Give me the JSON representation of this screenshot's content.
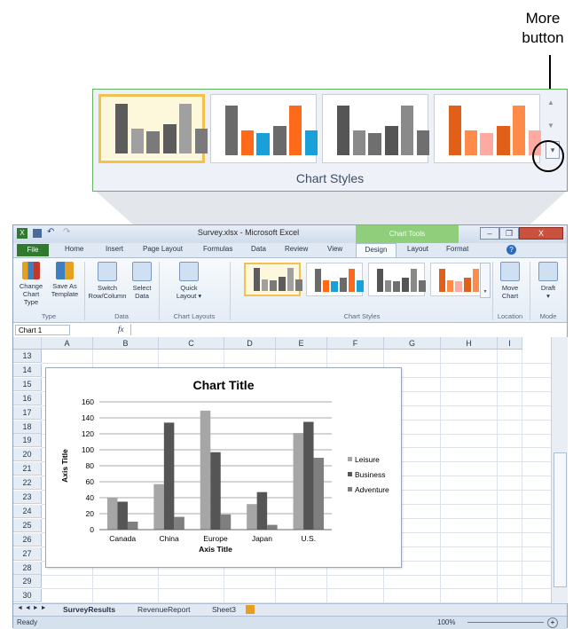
{
  "callout": {
    "line1": "More",
    "line2": "button"
  },
  "zoom": {
    "group_label": "Chart Styles"
  },
  "window": {
    "title": "Survey.xlsx - Microsoft Excel",
    "tools_label": "Chart Tools",
    "controls": {
      "minimize": "–",
      "restore": "❐",
      "close": "X"
    }
  },
  "tabs": [
    "Home",
    "Insert",
    "Page Layout",
    "Formulas",
    "Data",
    "Review",
    "View",
    "Design",
    "Layout",
    "Format"
  ],
  "file_tab": "File",
  "ribbon": {
    "change_type": {
      "line1": "Change",
      "line2": "Chart Type"
    },
    "save_template": {
      "line1": "Save As",
      "line2": "Template"
    },
    "group_type": "Type",
    "switch": {
      "line1": "Switch",
      "line2": "Row/Column"
    },
    "select_data": {
      "line1": "Select",
      "line2": "Data"
    },
    "group_data": "Data",
    "quick_layout": {
      "line1": "Quick",
      "line2": "Layout ▾"
    },
    "group_layouts": "Chart Layouts",
    "group_styles": "Chart Styles",
    "move_chart": {
      "line1": "Move",
      "line2": "Chart"
    },
    "group_location": "Location",
    "draft": {
      "line1": "Draft",
      "line2": "▾"
    },
    "group_mode": "Mode"
  },
  "formula_bar": {
    "name_box": "Chart 1",
    "fx": "fx"
  },
  "columns": [
    "A",
    "B",
    "C",
    "D",
    "E",
    "F",
    "G",
    "H",
    "I"
  ],
  "rows": [
    "13",
    "14",
    "15",
    "16",
    "17",
    "18",
    "19",
    "20",
    "21",
    "22",
    "23",
    "24",
    "25",
    "26",
    "27",
    "28",
    "29",
    "30"
  ],
  "sheet_tabs": [
    "SurveyResults",
    "RevenueReport",
    "Sheet3"
  ],
  "status": {
    "ready": "Ready",
    "zoom": "100%"
  },
  "chart_data": {
    "type": "bar",
    "title": "Chart Title",
    "xlabel": "Axis Title",
    "ylabel": "Axis Title",
    "categories": [
      "Canada",
      "China",
      "Europe",
      "Japan",
      "U.S."
    ],
    "series": [
      {
        "name": "Leisure",
        "values": [
          40,
          57,
          149,
          32,
          121
        ],
        "color": "#a6a6a6"
      },
      {
        "name": "Business",
        "values": [
          35,
          134,
          97,
          47,
          135
        ],
        "color": "#555555"
      },
      {
        "name": "Adventure",
        "values": [
          10,
          16,
          19,
          6,
          90
        ],
        "color": "#7f7f7f"
      }
    ],
    "ylim": [
      0,
      160
    ],
    "yticks": [
      "0",
      "20",
      "40",
      "60",
      "80",
      "100",
      "120",
      "140",
      "160"
    ],
    "grid": true,
    "legend": "right"
  },
  "style_thumbs": [
    {
      "colors": [
        "#5c5c5c",
        "#a0a0a0",
        "#7a7a7a"
      ]
    },
    {
      "colors": [
        "#6a6a6a",
        "#ff6a1a",
        "#1aa0d8"
      ]
    },
    {
      "colors": [
        "#555555",
        "#8a8a8a",
        "#6f6f6f"
      ]
    },
    {
      "colors": [
        "#e0601a",
        "#ff8a4a",
        "#ffaaa0"
      ]
    }
  ]
}
